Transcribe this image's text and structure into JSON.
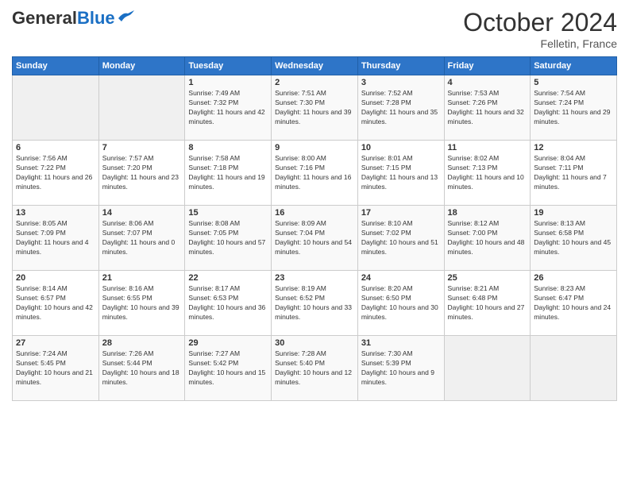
{
  "logo": {
    "general": "General",
    "blue": "Blue"
  },
  "header": {
    "month": "October 2024",
    "location": "Felletin, France"
  },
  "days_of_week": [
    "Sunday",
    "Monday",
    "Tuesday",
    "Wednesday",
    "Thursday",
    "Friday",
    "Saturday"
  ],
  "weeks": [
    [
      {
        "day": "",
        "empty": true
      },
      {
        "day": "",
        "empty": true
      },
      {
        "day": "1",
        "sunrise": "7:49 AM",
        "sunset": "7:32 PM",
        "daylight": "11 hours and 42 minutes."
      },
      {
        "day": "2",
        "sunrise": "7:51 AM",
        "sunset": "7:30 PM",
        "daylight": "11 hours and 39 minutes."
      },
      {
        "day": "3",
        "sunrise": "7:52 AM",
        "sunset": "7:28 PM",
        "daylight": "11 hours and 35 minutes."
      },
      {
        "day": "4",
        "sunrise": "7:53 AM",
        "sunset": "7:26 PM",
        "daylight": "11 hours and 32 minutes."
      },
      {
        "day": "5",
        "sunrise": "7:54 AM",
        "sunset": "7:24 PM",
        "daylight": "11 hours and 29 minutes."
      }
    ],
    [
      {
        "day": "6",
        "sunrise": "7:56 AM",
        "sunset": "7:22 PM",
        "daylight": "11 hours and 26 minutes."
      },
      {
        "day": "7",
        "sunrise": "7:57 AM",
        "sunset": "7:20 PM",
        "daylight": "11 hours and 23 minutes."
      },
      {
        "day": "8",
        "sunrise": "7:58 AM",
        "sunset": "7:18 PM",
        "daylight": "11 hours and 19 minutes."
      },
      {
        "day": "9",
        "sunrise": "8:00 AM",
        "sunset": "7:16 PM",
        "daylight": "11 hours and 16 minutes."
      },
      {
        "day": "10",
        "sunrise": "8:01 AM",
        "sunset": "7:15 PM",
        "daylight": "11 hours and 13 minutes."
      },
      {
        "day": "11",
        "sunrise": "8:02 AM",
        "sunset": "7:13 PM",
        "daylight": "11 hours and 10 minutes."
      },
      {
        "day": "12",
        "sunrise": "8:04 AM",
        "sunset": "7:11 PM",
        "daylight": "11 hours and 7 minutes."
      }
    ],
    [
      {
        "day": "13",
        "sunrise": "8:05 AM",
        "sunset": "7:09 PM",
        "daylight": "11 hours and 4 minutes."
      },
      {
        "day": "14",
        "sunrise": "8:06 AM",
        "sunset": "7:07 PM",
        "daylight": "11 hours and 0 minutes."
      },
      {
        "day": "15",
        "sunrise": "8:08 AM",
        "sunset": "7:05 PM",
        "daylight": "10 hours and 57 minutes."
      },
      {
        "day": "16",
        "sunrise": "8:09 AM",
        "sunset": "7:04 PM",
        "daylight": "10 hours and 54 minutes."
      },
      {
        "day": "17",
        "sunrise": "8:10 AM",
        "sunset": "7:02 PM",
        "daylight": "10 hours and 51 minutes."
      },
      {
        "day": "18",
        "sunrise": "8:12 AM",
        "sunset": "7:00 PM",
        "daylight": "10 hours and 48 minutes."
      },
      {
        "day": "19",
        "sunrise": "8:13 AM",
        "sunset": "6:58 PM",
        "daylight": "10 hours and 45 minutes."
      }
    ],
    [
      {
        "day": "20",
        "sunrise": "8:14 AM",
        "sunset": "6:57 PM",
        "daylight": "10 hours and 42 minutes."
      },
      {
        "day": "21",
        "sunrise": "8:16 AM",
        "sunset": "6:55 PM",
        "daylight": "10 hours and 39 minutes."
      },
      {
        "day": "22",
        "sunrise": "8:17 AM",
        "sunset": "6:53 PM",
        "daylight": "10 hours and 36 minutes."
      },
      {
        "day": "23",
        "sunrise": "8:19 AM",
        "sunset": "6:52 PM",
        "daylight": "10 hours and 33 minutes."
      },
      {
        "day": "24",
        "sunrise": "8:20 AM",
        "sunset": "6:50 PM",
        "daylight": "10 hours and 30 minutes."
      },
      {
        "day": "25",
        "sunrise": "8:21 AM",
        "sunset": "6:48 PM",
        "daylight": "10 hours and 27 minutes."
      },
      {
        "day": "26",
        "sunrise": "8:23 AM",
        "sunset": "6:47 PM",
        "daylight": "10 hours and 24 minutes."
      }
    ],
    [
      {
        "day": "27",
        "sunrise": "7:24 AM",
        "sunset": "5:45 PM",
        "daylight": "10 hours and 21 minutes."
      },
      {
        "day": "28",
        "sunrise": "7:26 AM",
        "sunset": "5:44 PM",
        "daylight": "10 hours and 18 minutes."
      },
      {
        "day": "29",
        "sunrise": "7:27 AM",
        "sunset": "5:42 PM",
        "daylight": "10 hours and 15 minutes."
      },
      {
        "day": "30",
        "sunrise": "7:28 AM",
        "sunset": "5:40 PM",
        "daylight": "10 hours and 12 minutes."
      },
      {
        "day": "31",
        "sunrise": "7:30 AM",
        "sunset": "5:39 PM",
        "daylight": "10 hours and 9 minutes."
      },
      {
        "day": "",
        "empty": true
      },
      {
        "day": "",
        "empty": true
      }
    ]
  ],
  "labels": {
    "sunrise": "Sunrise:",
    "sunset": "Sunset:",
    "daylight": "Daylight:"
  }
}
